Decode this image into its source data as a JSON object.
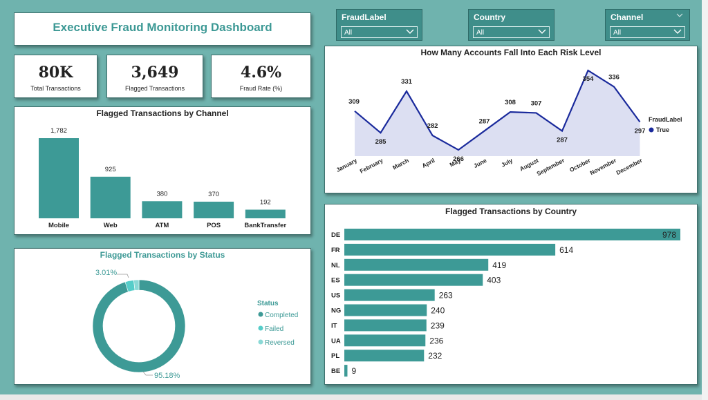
{
  "header": {
    "title": "Executive  Fraud Monitoring Dashboard"
  },
  "kpis": [
    {
      "value": "80K",
      "label": "Total Transactions"
    },
    {
      "value": "3,649",
      "label": "Flagged Transactions"
    },
    {
      "value": "4.6%",
      "label": "Fraud Rate (%)"
    }
  ],
  "slicers": [
    {
      "label": "FraudLabel",
      "value": "All"
    },
    {
      "label": "Country",
      "value": "All"
    },
    {
      "label": "Channel",
      "value": "All"
    }
  ],
  "colors": {
    "teal": "#3d9a96",
    "navy": "#1a2a9c",
    "area": "#dcdff2",
    "donut_completed": "#3d9a96",
    "donut_failed": "#56cdc9",
    "donut_reversed": "#8ad9d6"
  },
  "chart_data": [
    {
      "type": "bar",
      "title": "Flagged Transactions by Channel",
      "categories": [
        "Mobile",
        "Web",
        "ATM",
        "POS",
        "BankTransfer"
      ],
      "values": [
        1782,
        925,
        380,
        370,
        192
      ],
      "value_labels": [
        "1,782",
        "925",
        "380",
        "370",
        "192"
      ]
    },
    {
      "type": "area",
      "title": "How Many Accounts Fall Into Each Risk Level",
      "categories": [
        "January",
        "February",
        "March",
        "April",
        "May",
        "June",
        "July",
        "August",
        "September",
        "October",
        "November",
        "December"
      ],
      "series": [
        {
          "name": "True",
          "values": [
            309,
            285,
            331,
            282,
            266,
            287,
            308,
            307,
            287,
            354,
            336,
            297
          ]
        }
      ],
      "legend_title": "FraudLabel",
      "legend_position": "right"
    },
    {
      "type": "pie",
      "title": "Flagged Transactions by Status",
      "categories": [
        "Completed",
        "Failed",
        "Reversed"
      ],
      "values": [
        95.18,
        3.01,
        1.81
      ],
      "slice_labels": [
        "95.18%",
        "3.01%"
      ],
      "legend_title": "Status",
      "legend_position": "right"
    },
    {
      "type": "bar",
      "title": "Flagged Transactions by Country",
      "categories": [
        "DE",
        "FR",
        "NL",
        "ES",
        "US",
        "NG",
        "IT",
        "UA",
        "PL",
        "BE"
      ],
      "values": [
        978,
        614,
        419,
        403,
        263,
        240,
        239,
        236,
        232,
        9
      ],
      "value_labels": [
        "978",
        "614",
        "419",
        "403",
        "263",
        "240",
        "239",
        "236",
        "232",
        "9"
      ]
    }
  ]
}
